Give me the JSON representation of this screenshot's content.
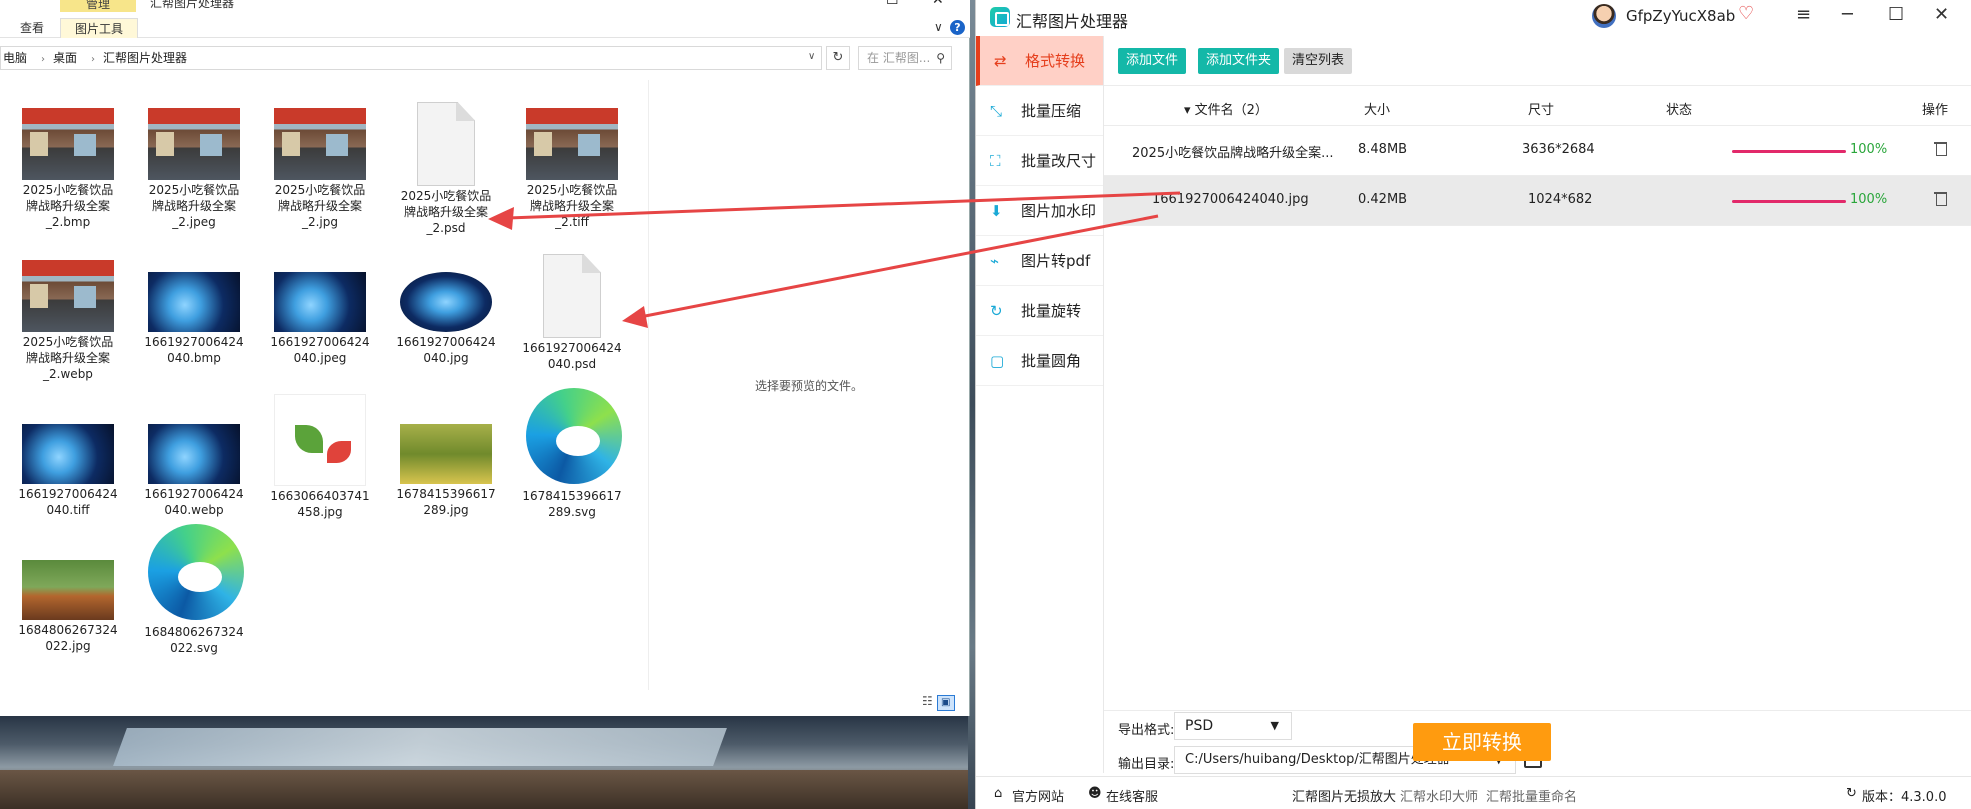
{
  "explorer": {
    "manage_tab": "管理",
    "window_title": "汇帮图片处理器",
    "ribbon_tabs": [
      "查看",
      "图片工具"
    ],
    "controls": {
      "minimize": "─",
      "maximize": "☐",
      "close": "✕",
      "expand": "∨",
      "help": "?"
    },
    "breadcrumb": [
      "电脑",
      "桌面",
      "汇帮图片处理器"
    ],
    "search_placeholder": "在 汇帮图...",
    "preview_message": "选择要预览的文件。",
    "files": [
      {
        "name": "2025小吃餐饮品牌战略升级全案_2.bmp",
        "lines": [
          "2025小吃餐饮品",
          "牌战略升级全案",
          "_2.bmp"
        ],
        "thumb": "store"
      },
      {
        "name": "2025小吃餐饮品牌战略升级全案_2.jpeg",
        "lines": [
          "2025小吃餐饮品",
          "牌战略升级全案",
          "_2.jpeg"
        ],
        "thumb": "store"
      },
      {
        "name": "2025小吃餐饮品牌战略升级全案_2.jpg",
        "lines": [
          "2025小吃餐饮品",
          "牌战略升级全案",
          "_2.jpg"
        ],
        "thumb": "store"
      },
      {
        "name": "2025小吃餐饮品牌战略升级全案_2.psd",
        "lines": [
          "2025小吃餐饮品",
          "牌战略升级全案",
          "_2.psd"
        ],
        "thumb": "doc"
      },
      {
        "name": "2025小吃餐饮品牌战略升级全案_2.tiff",
        "lines": [
          "2025小吃餐饮品",
          "牌战略升级全案",
          "_2.tiff"
        ],
        "thumb": "store"
      },
      {
        "name": "2025小吃餐饮品牌战略升级全案_2.webp",
        "lines": [
          "2025小吃餐饮品",
          "牌战略升级全案",
          "_2.webp"
        ],
        "thumb": "store"
      },
      {
        "name": "1661927006424040.bmp",
        "lines": [
          "1661927006424",
          "040.bmp"
        ],
        "thumb": "blue"
      },
      {
        "name": "1661927006424040.jpeg",
        "lines": [
          "1661927006424",
          "040.jpeg"
        ],
        "thumb": "blue"
      },
      {
        "name": "1661927006424040.jpg",
        "lines": [
          "1661927006424",
          "040.jpg"
        ],
        "thumb": "oval"
      },
      {
        "name": "1661927006424040.psd",
        "lines": [
          "1661927006424",
          "040.psd"
        ],
        "thumb": "doc"
      },
      {
        "name": "1661927006424040.tiff",
        "lines": [
          "1661927006424",
          "040.tiff"
        ],
        "thumb": "blue"
      },
      {
        "name": "1661927006424040.webp",
        "lines": [
          "1661927006424",
          "040.webp"
        ],
        "thumb": "blue"
      },
      {
        "name": "1663066403741458.jpg",
        "lines": [
          "1663066403741",
          "458.jpg"
        ],
        "thumb": "leaf"
      },
      {
        "name": "1678415396617289.jpg",
        "lines": [
          "1678415396617",
          "289.jpg"
        ],
        "thumb": "girl"
      },
      {
        "name": "1678415396617289.svg",
        "lines": [
          "1678415396617",
          "289.svg"
        ],
        "thumb": "edge"
      },
      {
        "name": "1684806267324022.jpg",
        "lines": [
          "1684806267324",
          "022.jpg"
        ],
        "thumb": "food"
      },
      {
        "name": "1684806267324022.svg",
        "lines": [
          "1684806267324",
          "022.svg"
        ],
        "thumb": "edge"
      }
    ]
  },
  "app": {
    "title": "汇帮图片处理器",
    "username": "GfpZyYucX8ab",
    "window_controls": {
      "menu": "≡",
      "minimize": "─",
      "maximize": "☐",
      "close": "✕"
    },
    "sidebar": [
      {
        "label": "格式转换",
        "icon": "convert-icon",
        "glyph": "⇄",
        "active": true
      },
      {
        "label": "批量压缩",
        "icon": "compress-icon",
        "glyph": "⤡",
        "active": false
      },
      {
        "label": "批量改尺寸",
        "icon": "resize-icon",
        "glyph": "⛶",
        "active": false
      },
      {
        "label": "图片加水印",
        "icon": "watermark-icon",
        "glyph": "⬇",
        "active": false
      },
      {
        "label": "图片转pdf",
        "icon": "pdf-icon",
        "glyph": "⌁",
        "active": false
      },
      {
        "label": "批量旋转",
        "icon": "rotate-icon",
        "glyph": "↻",
        "active": false
      },
      {
        "label": "批量圆角",
        "icon": "round-corner-icon",
        "glyph": "▢",
        "active": false
      }
    ],
    "toolbar": {
      "add_file": "添加文件",
      "add_folder": "添加文件夹",
      "clear_list": "清空列表"
    },
    "table": {
      "headers": {
        "name": "▾ 文件名（2）",
        "size": "大小",
        "dims": "尺寸",
        "status": "状态",
        "action": "操作"
      },
      "rows": [
        {
          "name": "2025小吃餐饮品牌战略升级全案...",
          "size": "8.48MB",
          "dims": "3636*2684",
          "progress": 100,
          "percent": "100%"
        },
        {
          "name": "1661927006424040.jpg",
          "size": "0.42MB",
          "dims": "1024*682",
          "progress": 100,
          "percent": "100%"
        }
      ]
    },
    "export": {
      "format_label": "导出格式:",
      "format_value": "PSD",
      "dir_label": "输出目录:",
      "dir_value": "C:/Users/huibang/Desktop/汇帮图片处理器"
    },
    "convert_button": "立即转换",
    "statusbar": {
      "official_site": "官方网站",
      "online_support": "在线客服",
      "link1": "汇帮图片无损放大",
      "link2": "汇帮水印大师",
      "link3": "汇帮批量重命名",
      "version": "版本：4.3.0.0"
    },
    "colors": {
      "accent": "#14b8a8",
      "active": "#e53e1c",
      "progress": "#e2296a",
      "convert": "#ff9b0f"
    }
  }
}
